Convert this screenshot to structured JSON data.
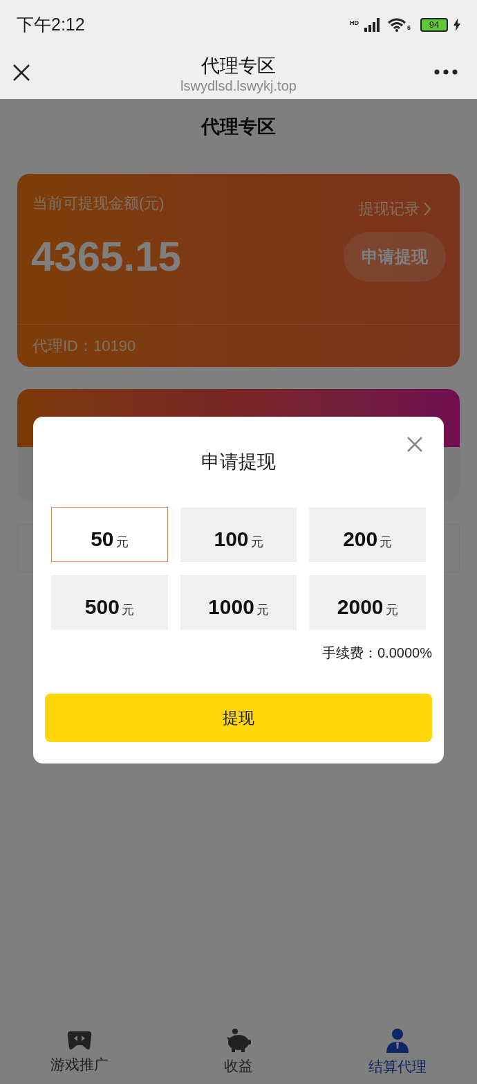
{
  "status_bar": {
    "time": "下午2:12",
    "network": "HD",
    "wifi": "6",
    "battery": "94"
  },
  "browser_bar": {
    "title": "代理专区",
    "url": "lswydlsd.lswykj.top"
  },
  "page": {
    "title": "代理专区",
    "balance_card": {
      "label": "当前可提现金额(元)",
      "record_link": "提现记录",
      "amount": "4365.15",
      "apply_button": "申请提现",
      "agent_id": "代理ID：10190"
    }
  },
  "withdraw_dialog": {
    "title": "申请提现",
    "options": [
      {
        "amount": "50",
        "unit": "元",
        "selected": true
      },
      {
        "amount": "100",
        "unit": "元",
        "selected": false
      },
      {
        "amount": "200",
        "unit": "元",
        "selected": false
      },
      {
        "amount": "500",
        "unit": "元",
        "selected": false
      },
      {
        "amount": "1000",
        "unit": "元",
        "selected": false
      },
      {
        "amount": "2000",
        "unit": "元",
        "selected": false
      }
    ],
    "fee": "手续费：0.0000%",
    "submit": "提现"
  },
  "tab_bar": [
    {
      "label": "游戏推广",
      "selected": false
    },
    {
      "label": "收益",
      "selected": false
    },
    {
      "label": "结算代理",
      "selected": true
    }
  ]
}
